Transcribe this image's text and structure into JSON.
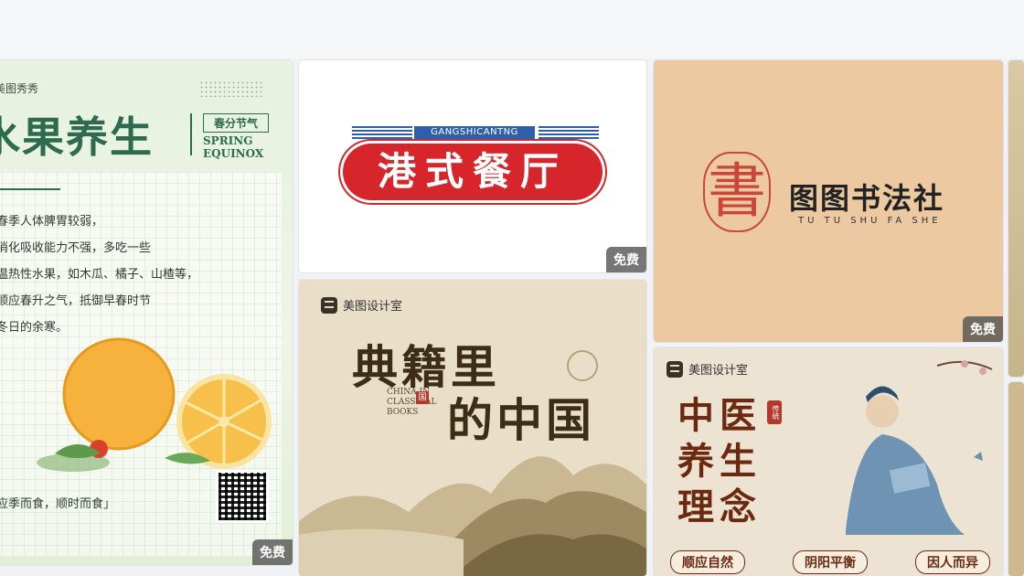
{
  "badge": {
    "free": "免费"
  },
  "cards": {
    "fruit": {
      "brand": "美图秀秀",
      "title": "水果养生",
      "tag_cn": "春分节气",
      "tag_en1": "SPRING",
      "tag_en2": "EQUINOX",
      "lines": [
        "春季人体脾胃较弱，",
        "消化吸收能力不强，多吃一些",
        "温热性水果，如木瓜、橘子、山楂等，",
        "顺应春升之气，抵御早春时节",
        "冬日的余寒。"
      ],
      "footer": "应季而食，顺时而食」"
    },
    "restaurant": {
      "small_en": "GANGSHICANTNG",
      "title": "港式餐厅"
    },
    "calligraphy": {
      "title": "图图书法社",
      "subtitle": "TU TU SHU FA SHE",
      "seal_char": "書"
    },
    "classics": {
      "brand": "美图设计室",
      "title_line1": "典籍里",
      "title_line2": "的中国",
      "en1": "CHINA IN",
      "en2": "CLASSICAL",
      "en3": "BOOKS",
      "seal": "国"
    },
    "tcm": {
      "brand": "美图设计室",
      "title_line1": "中医",
      "title_line2": "养生",
      "title_line3": "理念",
      "seal": "传统",
      "tags": [
        "顺应自然",
        "阴阳平衡",
        "因人而异"
      ]
    }
  },
  "colors": {
    "fruit_bg": "#e4f0da",
    "fruit_title": "#2d6a4f",
    "restaurant_red": "#d7262b",
    "restaurant_blue": "#2e5fa8",
    "calligraphy_bg": "#ecc9a0",
    "classics_bg": "#e9dfc9",
    "tcm_bg": "#ede3d2",
    "tcm_title": "#6b2a10"
  }
}
